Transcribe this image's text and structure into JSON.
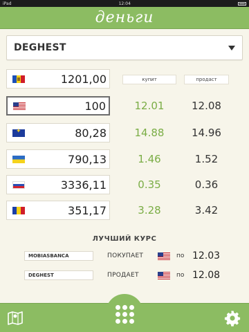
{
  "status_bar": {
    "device": "iPad",
    "time": "12:04"
  },
  "header": {
    "title": "деньги"
  },
  "bank_select": {
    "value": "DEGHEST",
    "icon": "chevron-down-icon"
  },
  "columns": {
    "buy_label": "купит",
    "sell_label": "продаст"
  },
  "currencies": [
    {
      "flag": "moldova-flag-icon",
      "amount": "1201,00",
      "buy": "",
      "sell": ""
    },
    {
      "flag": "usa-flag-icon",
      "amount": "100",
      "buy": "12.01",
      "sell": "12.08"
    },
    {
      "flag": "eu-flag-icon",
      "amount": "80,28",
      "buy": "14.88",
      "sell": "14.96"
    },
    {
      "flag": "ukraine-flag-icon",
      "amount": "790,13",
      "buy": "1.46",
      "sell": "1.52"
    },
    {
      "flag": "russia-flag-icon",
      "amount": "3336,11",
      "buy": "0.35",
      "sell": "0.36"
    },
    {
      "flag": "romania-flag-icon",
      "amount": "351,17",
      "buy": "3.28",
      "sell": "3.42"
    }
  ],
  "best_rate": {
    "title": "ЛУЧШИЙ КУРС",
    "rows": [
      {
        "bank": "MOBIASBANCA",
        "action": "ПОКУПАЕТ",
        "po": "по",
        "rate": "12.03"
      },
      {
        "bank": "DEGHEST",
        "action": "ПРОДАЕТ",
        "po": "по",
        "rate": "12.08"
      }
    ]
  },
  "bottom_bar": {
    "left_icon": "map-icon",
    "center_icon": "grid-menu-icon",
    "right_icon": "gear-icon"
  },
  "colors": {
    "accent_green": "#8cbc62",
    "buy_rate_green": "#7aad45",
    "background": "#f7f5ea"
  }
}
